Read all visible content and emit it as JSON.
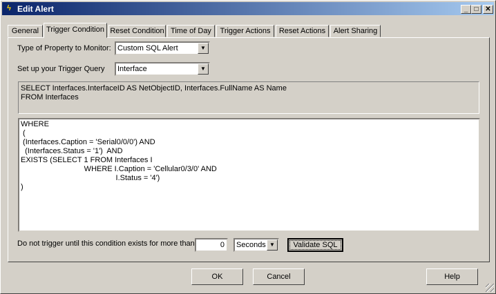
{
  "window": {
    "title": "Edit Alert",
    "controls": [
      "_",
      "□",
      "✕"
    ]
  },
  "tabs": [
    {
      "label": "General"
    },
    {
      "label": "Trigger Condition"
    },
    {
      "label": "Reset Condition"
    },
    {
      "label": "Time of Day"
    },
    {
      "label": "Trigger Actions"
    },
    {
      "label": "Reset Actions"
    },
    {
      "label": "Alert Sharing"
    }
  ],
  "active_tab": "Trigger Condition",
  "form": {
    "property_label": "Type of Property to Monitor:",
    "property_value": "Custom SQL Alert",
    "query_label": "Set up your Trigger Query",
    "query_value": "Interface",
    "select_text": "SELECT Interfaces.InterfaceID AS NetObjectID, Interfaces.FullName AS Name\nFROM Interfaces",
    "where_text": "WHERE\n (\n (Interfaces.Caption = 'Serial0/0/0') AND\n  (Interfaces.Status = '1')  AND\nEXISTS (SELECT 1 FROM Interfaces I\n                              WHERE I.Caption = 'Cellular0/3/0' AND\n                                             I.Status = '4')\n)",
    "duration_label": "Do not trigger until this condition exists for more than",
    "duration_value": "0",
    "duration_unit": "Seconds",
    "validate_label": "Validate SQL"
  },
  "buttons": {
    "ok": "OK",
    "cancel": "Cancel",
    "help": "Help"
  },
  "colors": {
    "titlebar_start": "#0a246a",
    "titlebar_end": "#a6caf0",
    "face": "#d4d0c8"
  }
}
